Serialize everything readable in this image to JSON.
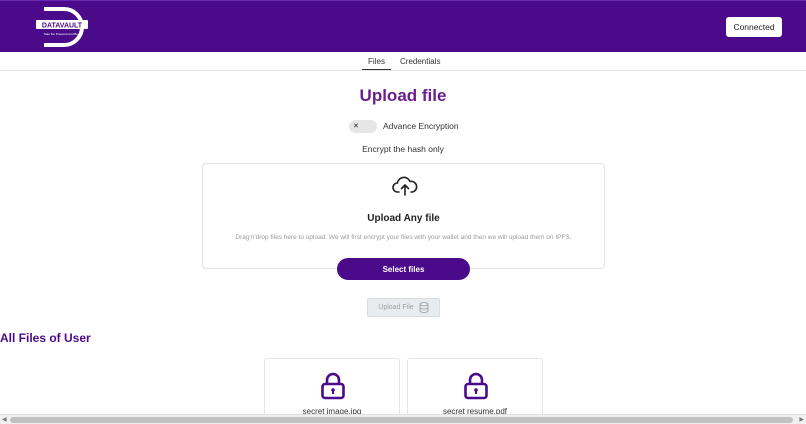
{
  "brand": {
    "name": "DATAVAULT",
    "tagline": "Take the Powered and Be...",
    "colors": {
      "primary": "#4a0a8a",
      "title": "#6b1f8f"
    }
  },
  "header": {
    "connected_label": "Connected"
  },
  "tabs": [
    {
      "label": "Files",
      "active": true
    },
    {
      "label": "Credentials",
      "active": false
    }
  ],
  "upload": {
    "title": "Upload file",
    "toggle_state": "✕",
    "toggle_label": "Advance Encryption",
    "hash_text": "Encrypt the hash only",
    "dropzone_icon": "cloud-upload-icon",
    "dropzone_title": "Upload Any file",
    "dropzone_desc": "Drag'n'drop files here to upload. We will first encrypt your files with your wallet and then we will upload them on IPFS.",
    "select_label": "Select files",
    "upload_label": "Upload File",
    "upload_icon": "database-icon"
  },
  "files": {
    "title": "All Files of User",
    "items": [
      {
        "name": "secret image.jpg",
        "icon": "lock-icon"
      },
      {
        "name": "secret resume.pdf",
        "icon": "lock-icon"
      }
    ]
  }
}
